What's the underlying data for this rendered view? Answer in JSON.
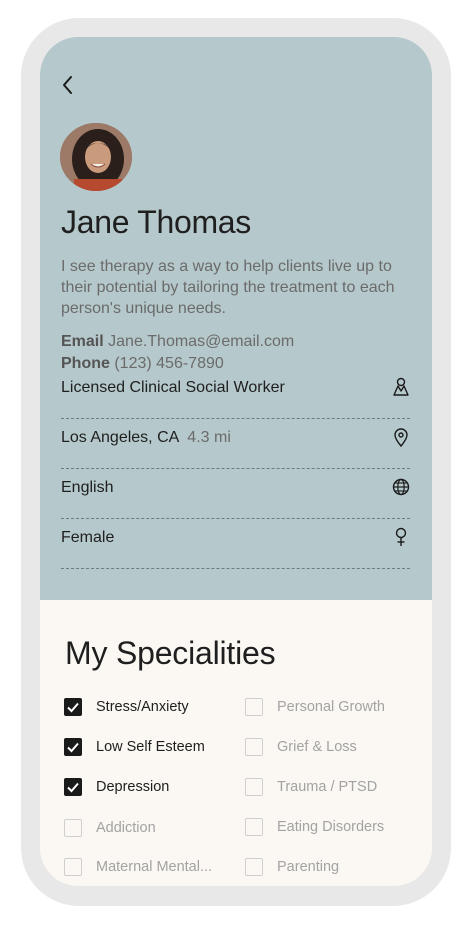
{
  "profile": {
    "name": "Jane Thomas",
    "bio": "I see therapy as a way to help clients live up to their potential by tailoring the treatment to each person's unique needs.",
    "email_label": "Email",
    "email": "Jane.Thomas@email.com",
    "phone_label": "Phone",
    "phone": "(123) 456-7890"
  },
  "details": [
    {
      "label": "Licensed Clinical Social Worker",
      "icon": "credential-icon"
    },
    {
      "label": "Los Angeles, CA",
      "sub": "4.3 mi",
      "icon": "location-pin-icon"
    },
    {
      "label": "English",
      "icon": "globe-icon"
    },
    {
      "label": "Female",
      "icon": "female-symbol-icon"
    }
  ],
  "specialities": {
    "title": "My Specialities",
    "items": [
      {
        "label": "Stress/Anxiety",
        "checked": true
      },
      {
        "label": "Personal Growth",
        "checked": false
      },
      {
        "label": "Low Self Esteem",
        "checked": true
      },
      {
        "label": "Grief & Loss",
        "checked": false
      },
      {
        "label": "Depression",
        "checked": true
      },
      {
        "label": "Trauma / PTSD",
        "checked": false
      },
      {
        "label": "Addiction",
        "checked": false
      },
      {
        "label": "Eating Disorders",
        "checked": false
      },
      {
        "label": "Maternal Mental...",
        "checked": false
      },
      {
        "label": "Parenting",
        "checked": false
      }
    ]
  },
  "colors": {
    "header_bg": "#b5c8cb",
    "content_bg": "#fbf7f3",
    "checkbox_checked": "#1a1a1a"
  }
}
